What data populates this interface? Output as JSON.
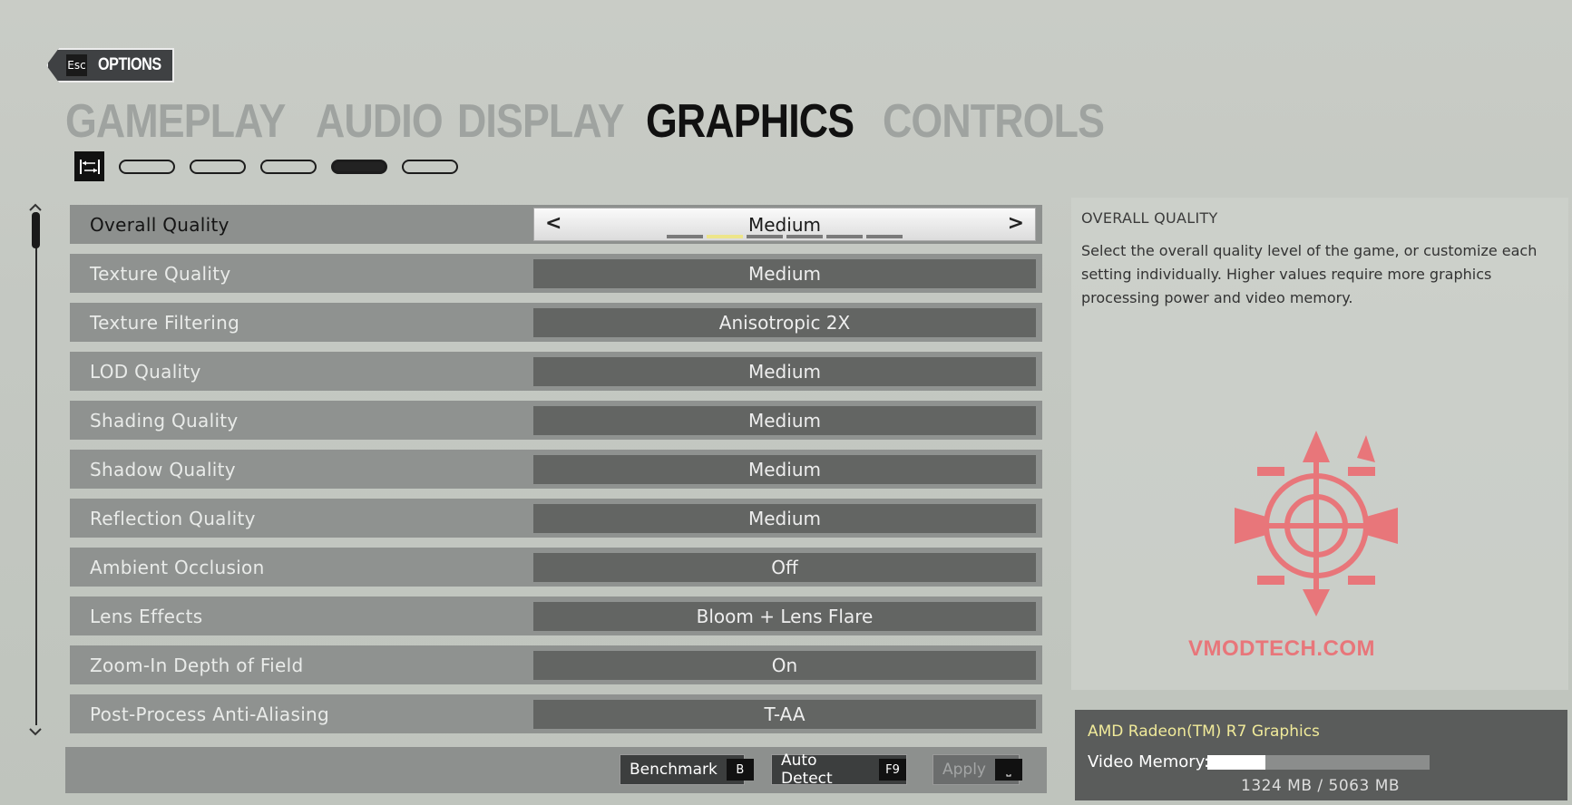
{
  "back": {
    "key": "Esc",
    "label": "OPTIONS"
  },
  "tabs": [
    {
      "label": "GAMEPLAY",
      "active": false
    },
    {
      "label": "AUDIO",
      "active": false
    },
    {
      "label": "DISPLAY",
      "active": false
    },
    {
      "label": "GRAPHICS",
      "active": true
    },
    {
      "label": "CONTROLS",
      "active": false
    }
  ],
  "subtabs": {
    "count": 5,
    "active_index": 3,
    "icon": "adjust-sliders-icon"
  },
  "settings": [
    {
      "name": "Overall Quality",
      "value": "Medium"
    },
    {
      "name": "Texture Quality",
      "value": "Medium"
    },
    {
      "name": "Texture Filtering",
      "value": "Anisotropic 2X"
    },
    {
      "name": "LOD Quality",
      "value": "Medium"
    },
    {
      "name": "Shading Quality",
      "value": "Medium"
    },
    {
      "name": "Shadow Quality",
      "value": "Medium"
    },
    {
      "name": "Reflection Quality",
      "value": "Medium"
    },
    {
      "name": "Ambient Occlusion",
      "value": "Off"
    },
    {
      "name": "Lens Effects",
      "value": "Bloom + Lens Flare"
    },
    {
      "name": "Zoom-In Depth of Field",
      "value": "On"
    },
    {
      "name": "Post-Process Anti-Aliasing",
      "value": "T-AA"
    }
  ],
  "selected_setting": {
    "arrow_left": "<",
    "arrow_right": ">",
    "level_count": 6,
    "level_index": 1
  },
  "buttons": {
    "benchmark": {
      "label": "Benchmark",
      "key": "B"
    },
    "auto_detect": {
      "label": "Auto Detect",
      "key": "F9"
    },
    "apply": {
      "label": "Apply",
      "key": "⎵"
    }
  },
  "info": {
    "title": "OVERALL QUALITY",
    "description": "Select the overall quality level of the game, or customize each setting individually. Higher values require more graphics processing power and video memory."
  },
  "watermark": {
    "text": "VMODTECH.COM"
  },
  "gpu": {
    "name": "AMD Radeon(TM) R7 Graphics",
    "memory_label": "Video Memory:",
    "memory_text": "1324 MB / 5063 MB",
    "memory_used_fraction": 0.26
  },
  "colors": {
    "accent": "#ede58a",
    "logo": "#e8767a"
  }
}
